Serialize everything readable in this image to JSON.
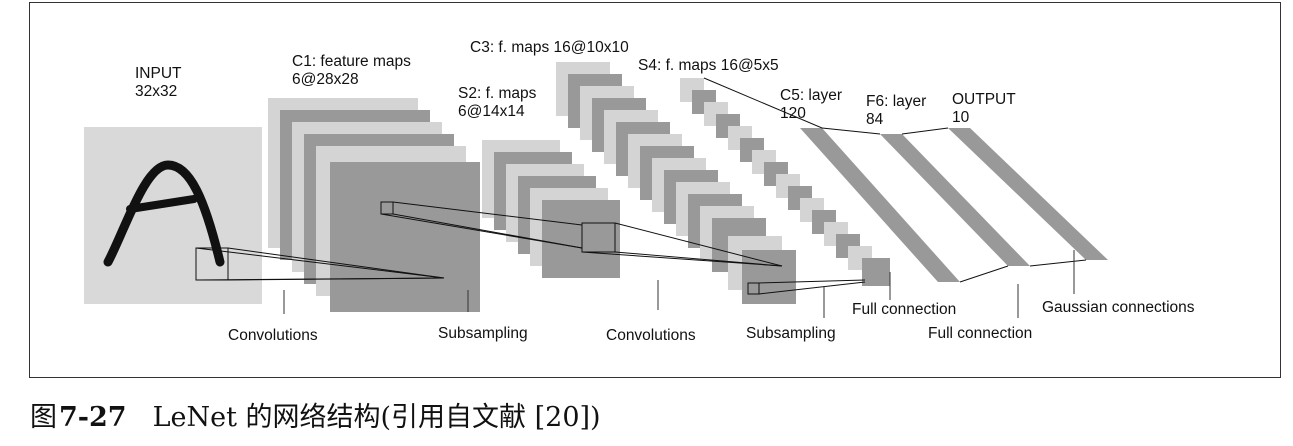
{
  "diagram": {
    "layers": [
      {
        "id": "input",
        "title": "INPUT",
        "size": "32x32"
      },
      {
        "id": "c1",
        "title": "C1: feature maps",
        "size": "6@28x28"
      },
      {
        "id": "s2",
        "title": "S2: f. maps",
        "size": "6@14x14"
      },
      {
        "id": "c3",
        "title": "C3: f. maps 16@10x10"
      },
      {
        "id": "s4",
        "title": "S4: f. maps 16@5x5"
      },
      {
        "id": "c5",
        "title": "C5: layer",
        "size": "120"
      },
      {
        "id": "f6",
        "title": "F6: layer",
        "size": "84"
      },
      {
        "id": "output",
        "title": "OUTPUT",
        "size": "10"
      }
    ],
    "operations": [
      {
        "id": "conv1",
        "label": "Convolutions"
      },
      {
        "id": "sub1",
        "label": "Subsampling"
      },
      {
        "id": "conv2",
        "label": "Convolutions"
      },
      {
        "id": "sub2",
        "label": "Subsampling"
      },
      {
        "id": "full1",
        "label": "Full connection"
      },
      {
        "id": "full2",
        "label": "Full connection"
      },
      {
        "id": "gauss",
        "label": "Gaussian connections"
      }
    ]
  },
  "caption": {
    "prefix": "图",
    "number": "7-27",
    "text": "LeNet 的网络结构(引用自文献 [20])"
  }
}
